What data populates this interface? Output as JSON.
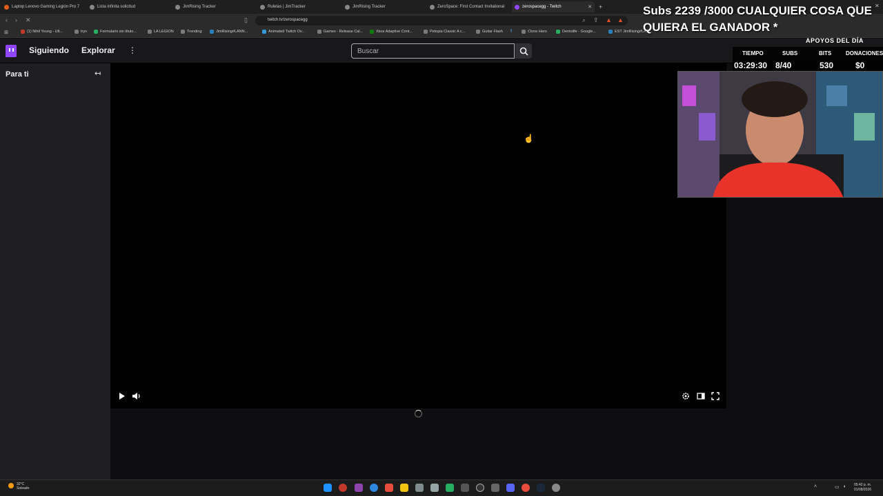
{
  "browser": {
    "tabs": [
      {
        "label": "Laptop Lenovo Gaming Legión Pro 7",
        "active": false
      },
      {
        "label": "Lista infinita solicitud",
        "active": false
      },
      {
        "label": "JimRising Tracker",
        "active": false
      },
      {
        "label": "Ruletas | JimTracker",
        "active": false
      },
      {
        "label": "JimRising Tracker",
        "active": false
      },
      {
        "label": "ZeroSpace: First Contact Invitational",
        "active": false
      },
      {
        "label": "zerospacegg - Twitch",
        "active": true
      }
    ],
    "new_tab_label": "+",
    "url": "twitch.tv/zerospacegg",
    "bookmarks": [
      "(1) Nihil Young - Ult...",
      "tryn",
      "Formulario sin título...",
      "LA LEGION",
      "Trending",
      "JimRising#LANN...",
      "Animated Twitch Ov...",
      "Games - Release Cal...",
      "Xbox Adaptive Cont...",
      "Petopia Classic A c...",
      "Guitar Flash",
      "Clone Hero",
      "Dentolife - Google...",
      "EST JimRising#LAN..."
    ]
  },
  "twitch": {
    "nav": {
      "following": "Siguiendo",
      "browse": "Explorar",
      "more": "⋮",
      "search_placeholder": "Buscar"
    },
    "sidebar": {
      "title": "Para ti",
      "collapse_icon": "↤"
    }
  },
  "overlay": {
    "title": "Subs 2239 /3000 CUALQUIER COSA QUE QUIERA EL GANADOR *",
    "apoyos_label": "APOYOS DEL DÍA",
    "stats": [
      {
        "label": "TIEMPO",
        "value": "03:29:30"
      },
      {
        "label": "SUBS",
        "value": "8/40"
      },
      {
        "label": "BITS",
        "value": "530"
      },
      {
        "label": "DONACIONES",
        "value": "$0"
      }
    ]
  },
  "taskbar": {
    "weather_temp": "32°C",
    "weather_desc": "Soleado",
    "time": "05:42 p. m.",
    "date": "01/08/2026"
  },
  "colors": {
    "twitch_purple": "#9147ff",
    "page_bg": "#0e0e10",
    "sidebar_bg": "#1f1f23"
  }
}
